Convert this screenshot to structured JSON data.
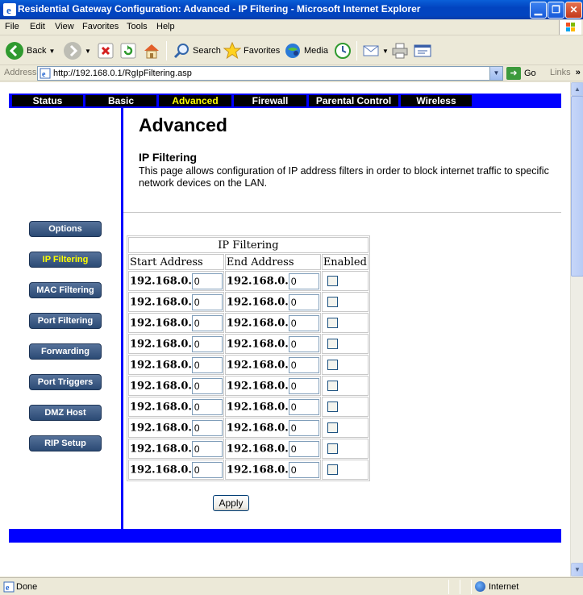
{
  "window": {
    "title": "Residential Gateway Configuration: Advanced - IP Filtering - Microsoft Internet Explorer"
  },
  "menu": [
    "File",
    "Edit",
    "View",
    "Favorites",
    "Tools",
    "Help"
  ],
  "toolbar": {
    "back": "Back",
    "search": "Search",
    "favorites": "Favorites",
    "media": "Media"
  },
  "address": {
    "label": "Address",
    "url": "http://192.168.0.1/RgIpFiltering.asp",
    "go": "Go",
    "links": "Links"
  },
  "nav": {
    "tabs": [
      "Status",
      "Basic",
      "Advanced",
      "Firewall",
      "Parental Control",
      "Wireless"
    ],
    "active": "Advanced"
  },
  "page": {
    "title": "Advanced",
    "subtitle": "IP Filtering",
    "description": "This page allows configuration of IP address filters in order to block internet traffic to specific network devices on the LAN."
  },
  "sidebar": {
    "items": [
      "Options",
      "IP Filtering",
      "MAC Filtering",
      "Port Filtering",
      "Forwarding",
      "Port Triggers",
      "DMZ Host",
      "RIP Setup"
    ],
    "active": "IP Filtering"
  },
  "table": {
    "caption": "IP Filtering",
    "headers": [
      "Start Address",
      "End Address",
      "Enabled"
    ],
    "rows": [
      {
        "start_prefix": "192.168.0.",
        "start_value": "0",
        "end_prefix": "192.168.0.",
        "end_value": "0",
        "enabled": false
      },
      {
        "start_prefix": "192.168.0.",
        "start_value": "0",
        "end_prefix": "192.168.0.",
        "end_value": "0",
        "enabled": false
      },
      {
        "start_prefix": "192.168.0.",
        "start_value": "0",
        "end_prefix": "192.168.0.",
        "end_value": "0",
        "enabled": false
      },
      {
        "start_prefix": "192.168.0.",
        "start_value": "0",
        "end_prefix": "192.168.0.",
        "end_value": "0",
        "enabled": false
      },
      {
        "start_prefix": "192.168.0.",
        "start_value": "0",
        "end_prefix": "192.168.0.",
        "end_value": "0",
        "enabled": false
      },
      {
        "start_prefix": "192.168.0.",
        "start_value": "0",
        "end_prefix": "192.168.0.",
        "end_value": "0",
        "enabled": false
      },
      {
        "start_prefix": "192.168.0.",
        "start_value": "0",
        "end_prefix": "192.168.0.",
        "end_value": "0",
        "enabled": false
      },
      {
        "start_prefix": "192.168.0.",
        "start_value": "0",
        "end_prefix": "192.168.0.",
        "end_value": "0",
        "enabled": false
      },
      {
        "start_prefix": "192.168.0.",
        "start_value": "0",
        "end_prefix": "192.168.0.",
        "end_value": "0",
        "enabled": false
      },
      {
        "start_prefix": "192.168.0.",
        "start_value": "0",
        "end_prefix": "192.168.0.",
        "end_value": "0",
        "enabled": false
      }
    ]
  },
  "apply_label": "Apply",
  "status": {
    "text": "Done",
    "zone": "Internet"
  },
  "colors": {
    "nav_bar": "#0000ff",
    "nav_tab": "#000000",
    "active_tab_text": "#ffff00",
    "side_button": "#2b4a74",
    "active_side_text": "#ffff00"
  }
}
